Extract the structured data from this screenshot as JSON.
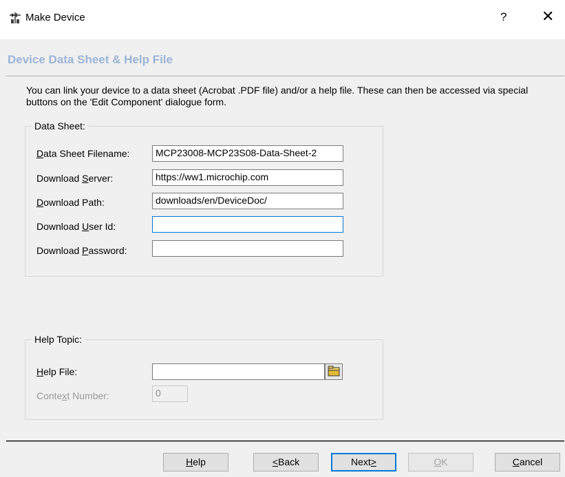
{
  "window": {
    "title": "Make Device",
    "help_glyph": "?",
    "close_glyph": "✕"
  },
  "page": {
    "section_title": "Device Data Sheet & Help File",
    "description": "You can link your device to a data sheet (Acrobat .PDF file) and/or a help file. These can then be accessed via special buttons on the 'Edit Component' dialogue form."
  },
  "data_sheet": {
    "legend": "Data Sheet:",
    "fields": [
      {
        "label_pre": "",
        "label_key": "D",
        "label_post": "ata Sheet Filename:",
        "value": "MCP23008-MCP23S08-Data-Sheet-2"
      },
      {
        "label_pre": "Download ",
        "label_key": "S",
        "label_post": "erver:",
        "value": "https://ww1.microchip.com"
      },
      {
        "label_pre": "",
        "label_key": "D",
        "label_post": "ownload Path:",
        "value": "downloads/en/DeviceDoc/"
      },
      {
        "label_pre": "Download ",
        "label_key": "U",
        "label_post": "ser Id:",
        "value": ""
      },
      {
        "label_pre": "Download ",
        "label_key": "P",
        "label_post": "assword:",
        "value": ""
      }
    ]
  },
  "help_topic": {
    "legend": "Help Topic:",
    "help_file": {
      "label_pre": "",
      "label_key": "H",
      "label_post": "elp File:",
      "value": ""
    },
    "context_number": {
      "label_pre": "Conte",
      "label_key": "x",
      "label_post": "t Number:",
      "value": "0"
    }
  },
  "buttons": {
    "help": {
      "pre": "",
      "key": "H",
      "post": "elp"
    },
    "back": {
      "pre": "",
      "key": "<",
      "post": "Back"
    },
    "next": {
      "pre": "Next",
      "key": ">",
      "post": ""
    },
    "ok": {
      "pre": "",
      "key": "O",
      "post": "K"
    },
    "cancel": {
      "pre": "",
      "key": "C",
      "post": "ancel"
    }
  }
}
